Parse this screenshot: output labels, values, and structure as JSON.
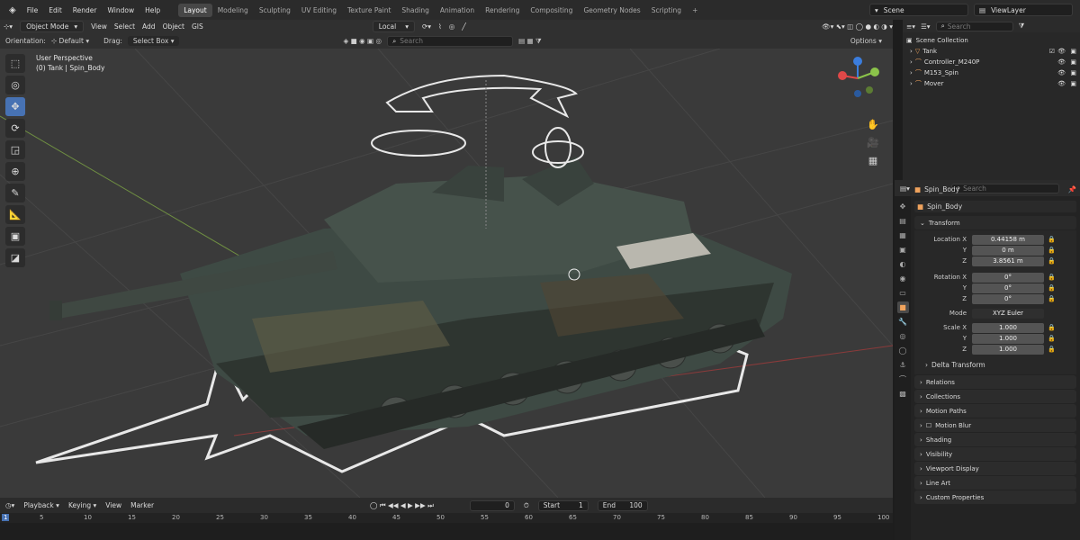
{
  "menu": [
    "File",
    "Edit",
    "Render",
    "Window",
    "Help"
  ],
  "workspaces": [
    "Layout",
    "Modeling",
    "Sculpting",
    "UV Editing",
    "Texture Paint",
    "Shading",
    "Animation",
    "Rendering",
    "Compositing",
    "Geometry Nodes",
    "Scripting"
  ],
  "active_workspace": "Layout",
  "scene": {
    "label": "Scene",
    "view_layer": "ViewLayer"
  },
  "header": {
    "mode": "Object Mode",
    "view": "View",
    "select": "Select",
    "add": "Add",
    "object": "Object",
    "gis": "GIS",
    "transform_orientation": "Local",
    "search_placeholder": "Search"
  },
  "header2": {
    "orientation_label": "Orientation:",
    "orientation": "Default",
    "drag_label": "Drag:",
    "drag": "Select Box",
    "options": "Options"
  },
  "viewport": {
    "line1": "User Perspective",
    "line2": "(0) Tank | Spin_Body"
  },
  "outliner": {
    "title": "Scene Collection",
    "search_placeholder": "Search",
    "items": [
      {
        "name": "Tank"
      },
      {
        "name": "Controller_M240P"
      },
      {
        "name": "M153_Spin"
      },
      {
        "name": "Mover"
      }
    ]
  },
  "properties": {
    "search_placeholder": "Search",
    "object_name": "Spin_Body",
    "object_data": "Spin_Body",
    "transform_label": "Transform",
    "location_label": "Location X",
    "location": [
      "0.44158 m",
      "0 m",
      "3.8561 m"
    ],
    "rotation_label": "Rotation X",
    "rotation": [
      "0°",
      "0°",
      "0°"
    ],
    "mode_label": "Mode",
    "mode": "XYZ Euler",
    "scale_label": "Scale X",
    "scale": [
      "1.000",
      "1.000",
      "1.000"
    ],
    "axis_y": "Y",
    "axis_z": "Z",
    "delta": "Delta Transform",
    "panels": [
      "Relations",
      "Collections",
      "Motion Paths",
      "Motion Blur",
      "Shading",
      "Visibility",
      "Viewport Display",
      "Line Art",
      "Custom Properties"
    ]
  },
  "timeline": {
    "playback": "Playback",
    "keying": "Keying",
    "view": "View",
    "marker": "Marker",
    "current_frame": "0",
    "start_label": "Start",
    "start": "1",
    "end_label": "End",
    "end": "100",
    "ticks": [
      "5",
      "10",
      "15",
      "20",
      "25",
      "30",
      "35",
      "40",
      "45",
      "50",
      "55",
      "60",
      "65",
      "70",
      "75",
      "80",
      "85",
      "90",
      "95",
      "100"
    ],
    "first_tick": "1"
  },
  "colors": {
    "accent": "#4772b3",
    "header": "#303030",
    "panel": "#232323"
  }
}
